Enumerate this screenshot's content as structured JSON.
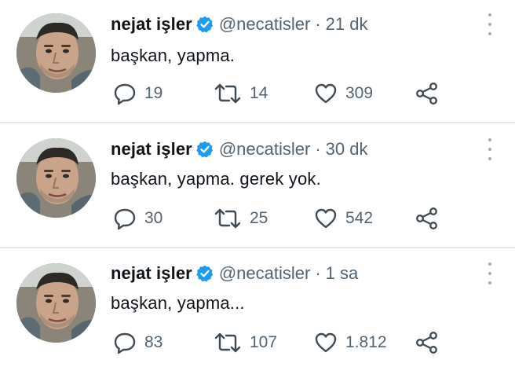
{
  "tweets": [
    {
      "name": "nejat işler",
      "handle": "@necatisler",
      "separator": "·",
      "time": "21 dk",
      "text": "başkan, yapma.",
      "replies": "19",
      "retweets": "14",
      "likes": "309"
    },
    {
      "name": "nejat işler",
      "handle": "@necatisler",
      "separator": "·",
      "time": "30 dk",
      "text": "başkan, yapma. gerek yok.",
      "replies": "30",
      "retweets": "25",
      "likes": "542"
    },
    {
      "name": "nejat işler",
      "handle": "@necatisler",
      "separator": "·",
      "time": "1 sa",
      "text": "başkan, yapma...",
      "replies": "83",
      "retweets": "107",
      "likes": "1.812"
    }
  ],
  "icons": {
    "verified": "verified-badge-icon",
    "more": "more-options-icon",
    "reply": "reply-icon",
    "retweet": "retweet-icon",
    "like": "like-icon",
    "share": "share-icon"
  },
  "colors": {
    "verified_badge": "#1d9bf0",
    "name_text": "#0f1419",
    "secondary_text": "#536471",
    "divider": "#e3e6e8"
  }
}
